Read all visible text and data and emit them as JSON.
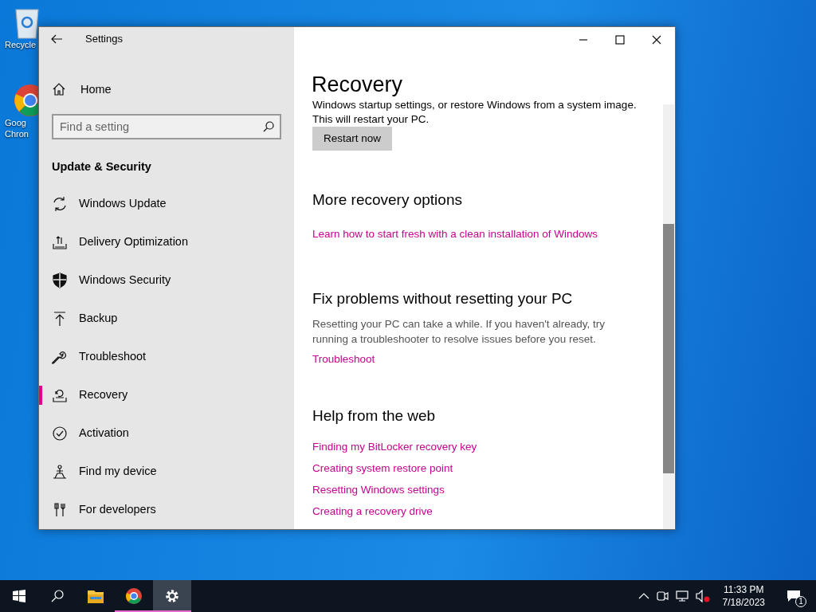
{
  "desktop_icons": [
    {
      "label": "Recycle"
    },
    {
      "label": "Goog\nChron"
    }
  ],
  "window": {
    "title": "Settings"
  },
  "sidebar": {
    "home": "Home",
    "search": {
      "placeholder": "Find a setting"
    },
    "section": "Update & Security",
    "items": [
      {
        "label": "Windows Update",
        "selected": false
      },
      {
        "label": "Delivery Optimization",
        "selected": false
      },
      {
        "label": "Windows Security",
        "selected": false
      },
      {
        "label": "Backup",
        "selected": false
      },
      {
        "label": "Troubleshoot",
        "selected": false
      },
      {
        "label": "Recovery",
        "selected": true
      },
      {
        "label": "Activation",
        "selected": false
      },
      {
        "label": "Find my device",
        "selected": false
      },
      {
        "label": "For developers",
        "selected": false
      }
    ]
  },
  "content": {
    "title": "Recovery",
    "intro": "Windows startup settings, or restore Windows from a system image.",
    "intro2": "This will restart your PC.",
    "button": "Restart now",
    "sections": [
      {
        "heading": "More recovery options",
        "links": [
          "Learn how to start fresh with a clean installation of Windows"
        ]
      },
      {
        "heading": "Fix problems without resetting your PC",
        "text": "Resetting your PC can take a while. If you haven't already, try running a troubleshooter to resolve issues before you reset.",
        "links": [
          "Troubleshoot"
        ]
      },
      {
        "heading": "Help from the web",
        "links": [
          "Finding my BitLocker recovery key",
          "Creating system restore point",
          "Resetting Windows settings",
          "Creating a recovery drive"
        ]
      }
    ]
  },
  "taskbar": {
    "apps": [
      {
        "running": false,
        "selected": false
      },
      {
        "running": true,
        "selected": false
      },
      {
        "running": true,
        "selected": true
      }
    ],
    "time": "11:33 PM",
    "date": "7/18/2023",
    "notifications": "1"
  }
}
